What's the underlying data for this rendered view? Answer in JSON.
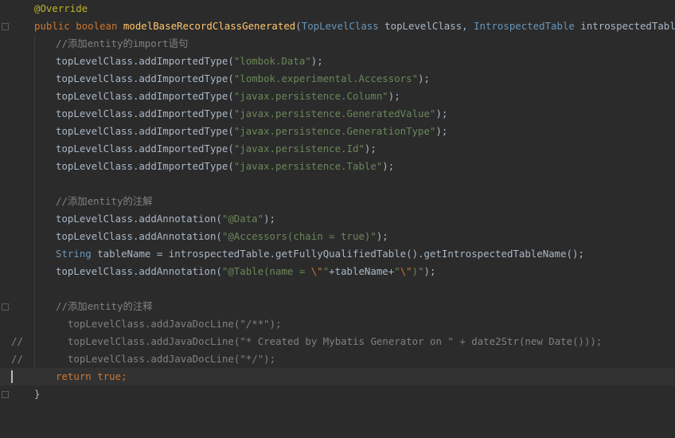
{
  "colors": {
    "background": "#2b2b2b",
    "keyword": "#cc7832",
    "annotation": "#bbb529",
    "method_declaration": "#ffc66d",
    "type": "#6897bb",
    "string": "#6a8759",
    "comment": "#808080",
    "default_text": "#a9b7c6"
  },
  "code": {
    "l1": {
      "annotation": "@Override"
    },
    "l2": {
      "kw1": "public",
      "kw2": "boolean",
      "method": "modelBaseRecordClassGenerated",
      "p1": "(",
      "t1": "TopLevelClass",
      "p2": " topLevelClass, ",
      "t2": "IntrospectedTable",
      "p3": " introspectedTable) {"
    },
    "l3": {
      "comment": "//添加entity的import语句"
    },
    "imports": [
      {
        "prefix": "topLevelClass.addImportedType(",
        "str": "\"lombok.Data\"",
        "suffix": ");"
      },
      {
        "prefix": "topLevelClass.addImportedType(",
        "str": "\"lombok.experimental.Accessors\"",
        "suffix": ");"
      },
      {
        "prefix": "topLevelClass.addImportedType(",
        "str": "\"javax.persistence.Column\"",
        "suffix": ");"
      },
      {
        "prefix": "topLevelClass.addImportedType(",
        "str": "\"javax.persistence.GeneratedValue\"",
        "suffix": ");"
      },
      {
        "prefix": "topLevelClass.addImportedType(",
        "str": "\"javax.persistence.GenerationType\"",
        "suffix": ");"
      },
      {
        "prefix": "topLevelClass.addImportedType(",
        "str": "\"javax.persistence.Id\"",
        "suffix": ");"
      },
      {
        "prefix": "topLevelClass.addImportedType(",
        "str": "\"javax.persistence.Table\"",
        "suffix": ");"
      }
    ],
    "l12": {
      "comment": "//添加entity的注解"
    },
    "l13": {
      "prefix": "topLevelClass.addAnnotation(",
      "str": "\"@Data\"",
      "suffix": ");"
    },
    "l14": {
      "prefix": "topLevelClass.addAnnotation(",
      "str": "\"@Accessors(chain = true)\"",
      "suffix": ");"
    },
    "l15": {
      "type": "String",
      "rest": " tableName = introspectedTable.getFullyQualifiedTable().getIntrospectedTableName();"
    },
    "l16": {
      "prefix": "topLevelClass.addAnnotation(",
      "s1": "\"@Table(name = ",
      "e1": "\\\"",
      "s2": "\"",
      "mid": "+tableName+",
      "s3": "\"",
      "e2": "\\\"",
      "s4": ")\"",
      "suffix": ");"
    },
    "l18": {
      "comment": "//添加entity的注释"
    },
    "commented": [
      {
        "marker": "//",
        "text": "topLevelClass.addJavaDocLine(\"/**\");"
      },
      {
        "marker": "//",
        "text": "topLevelClass.addJavaDocLine(\"* Created by Mybatis Generator on \" + date2Str(new Date()));"
      },
      {
        "marker": "//",
        "text": "topLevelClass.addJavaDocLine(\"*/\");"
      }
    ],
    "l22": {
      "kw1": "return",
      "kw2": "true",
      "semi": ";"
    },
    "l23": {
      "brace": "}"
    }
  }
}
